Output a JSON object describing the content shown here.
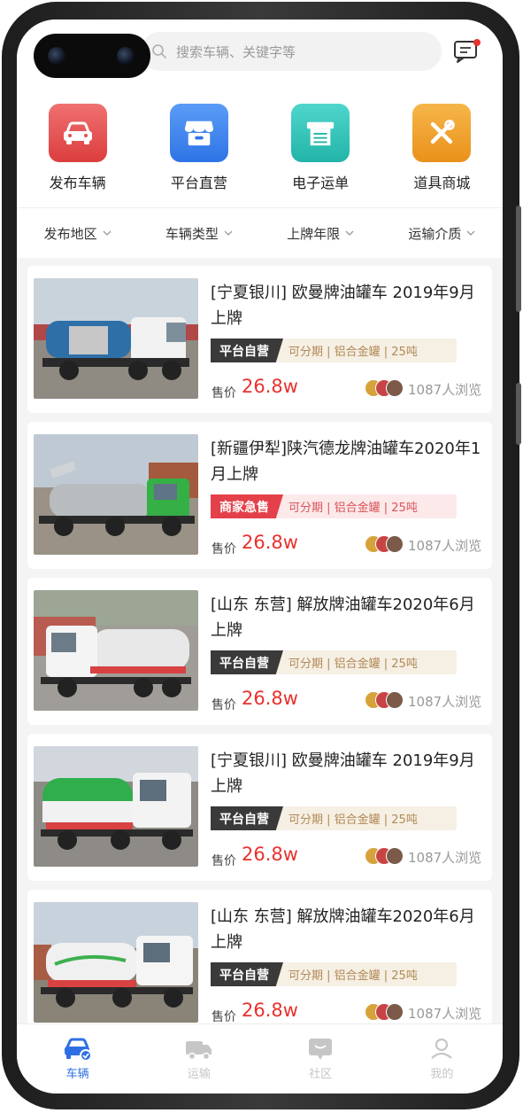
{
  "search": {
    "placeholder": "搜索车辆、关键字等"
  },
  "quick_actions": [
    {
      "label": "发布车辆",
      "icon": "car-icon",
      "color": "#e64e4e"
    },
    {
      "label": "平台直营",
      "icon": "store-icon",
      "color": "#3e86f0"
    },
    {
      "label": "电子运单",
      "icon": "printer-icon",
      "color": "#2dc3b8"
    },
    {
      "label": "道具商城",
      "icon": "tools-icon",
      "color": "#ee9a1e"
    }
  ],
  "filters": [
    "发布地区",
    "车辆类型",
    "上牌年限",
    "运输介质"
  ],
  "listings": [
    {
      "title": "[宁夏银川] 欧曼牌油罐车 2019年9月上牌",
      "tag": "平台自营",
      "tag_type": "platform",
      "features": "可分期 | 铝合金罐 | 25吨",
      "price_label": "售价",
      "price": "26.8w",
      "views": "1087人浏览"
    },
    {
      "title": "[新疆伊犁]陕汽德龙牌油罐车2020年1月上牌",
      "tag": "商家急售",
      "tag_type": "urgent",
      "features": "可分期 | 铝合金罐 | 25吨",
      "price_label": "售价",
      "price": "26.8w",
      "views": "1087人浏览"
    },
    {
      "title": "[山东 东营] 解放牌油罐车2020年6月上牌",
      "tag": "平台自营",
      "tag_type": "platform",
      "features": "可分期 | 铝合金罐 | 25吨",
      "price_label": "售价",
      "price": "26.8w",
      "views": "1087人浏览"
    },
    {
      "title": "[宁夏银川] 欧曼牌油罐车 2019年9月上牌",
      "tag": "平台自营",
      "tag_type": "platform",
      "features": "可分期 | 铝合金罐 | 25吨",
      "price_label": "售价",
      "price": "26.8w",
      "views": "1087人浏览"
    },
    {
      "title": "[山东 东营] 解放牌油罐车2020年6月上牌",
      "tag": "平台自营",
      "tag_type": "platform",
      "features": "可分期 | 铝合金罐 | 25吨",
      "price_label": "售价",
      "price": "26.8w",
      "views": "1087人浏览"
    }
  ],
  "tabs": [
    {
      "label": "车辆",
      "icon": "car-tab-icon",
      "active": true
    },
    {
      "label": "运输",
      "icon": "truck-tab-icon",
      "active": false
    },
    {
      "label": "社区",
      "icon": "chat-tab-icon",
      "active": false
    },
    {
      "label": "我的",
      "icon": "profile-tab-icon",
      "active": false
    }
  ],
  "colors": {
    "price": "#e8322e",
    "tab_active": "#2f6fe4",
    "tab_inactive": "#c6c6c6",
    "tag_platform": "#3a3a3a",
    "tag_platform_rest_bg": "#f6efe4",
    "tag_platform_rest_text": "#b08a55",
    "tag_urgent": "#e4404a",
    "tag_urgent_rest_bg": "#fce9ea",
    "tag_urgent_rest_text": "#d7545b"
  }
}
